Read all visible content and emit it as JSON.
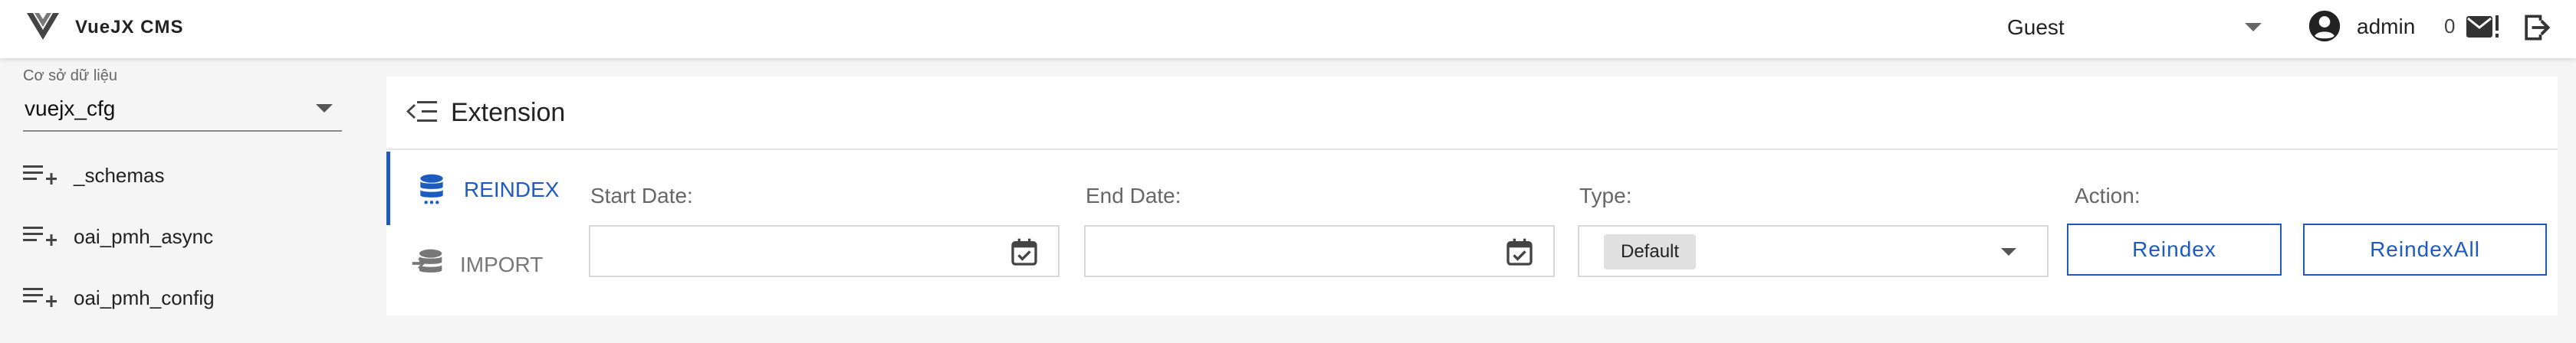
{
  "app": {
    "title": "VueJX CMS"
  },
  "header": {
    "user_select_value": "Guest",
    "account_name": "admin",
    "mail_count": "0",
    "icons": {
      "logo": "vuejx-logo",
      "account": "account-circle-icon",
      "mail": "mail-alert-icon",
      "logout": "logout-icon"
    }
  },
  "sidebar": {
    "db_label": "Cơ sở dữ liệu",
    "db_value": "vuejx_cfg",
    "items": [
      {
        "label": "_schemas",
        "icon": "playlist-add-icon"
      },
      {
        "label": "oai_pmh_async",
        "icon": "playlist-add-icon"
      },
      {
        "label": "oai_pmh_config",
        "icon": "playlist-add-icon"
      }
    ]
  },
  "panel": {
    "title": "Extension",
    "tabs": [
      {
        "label": "REINDEX",
        "icon": "database-icon",
        "active": true
      },
      {
        "label": "IMPORT",
        "icon": "database-import-icon",
        "active": false
      }
    ],
    "form": {
      "start_date_label": "Start Date:",
      "start_date_value": "",
      "end_date_label": "End Date:",
      "end_date_value": "",
      "type_label": "Type:",
      "type_value": "Default",
      "action_label": "Action:",
      "reindex_button": "Reindex",
      "reindex_all_button": "ReindexAll"
    }
  },
  "colors": {
    "accent": "#1e5bbf",
    "background": "#f5f5f5",
    "chip": "#e0e0e0"
  }
}
